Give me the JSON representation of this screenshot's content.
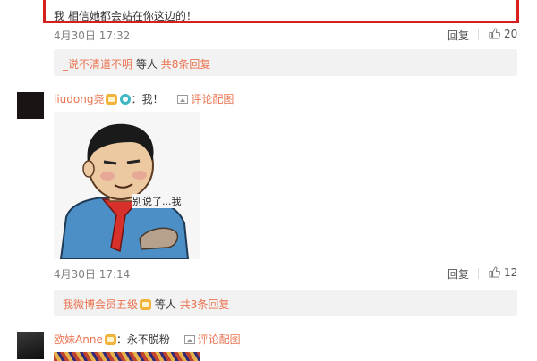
{
  "top_comment": {
    "text": "我 相信她都会站在你这边的！",
    "date": "4月30日 17:32",
    "reply_label": "回复",
    "likes": "20",
    "sub_reply": {
      "user": "_说不清道不明",
      "middle": "等人",
      "count_link": "共8条回复"
    }
  },
  "comment_liudong": {
    "username": "liudong尧",
    "text": "：我！",
    "pic_label": "评论配图",
    "meme_caption": "别说了...我",
    "date": "4月30日 17:14",
    "reply_label": "回复",
    "likes": "12",
    "sub_reply": {
      "user": "我微博会员五级",
      "middle": "等人",
      "count_link": "共3条回复"
    }
  },
  "comment_anne": {
    "username": "欧妹Anne",
    "text": "：永不脱粉",
    "pic_label": "评论配图"
  },
  "colors": {
    "accent": "#eb7350",
    "highlight": "#d71f1f",
    "sub_reply_bg": "#f2f2f2"
  }
}
